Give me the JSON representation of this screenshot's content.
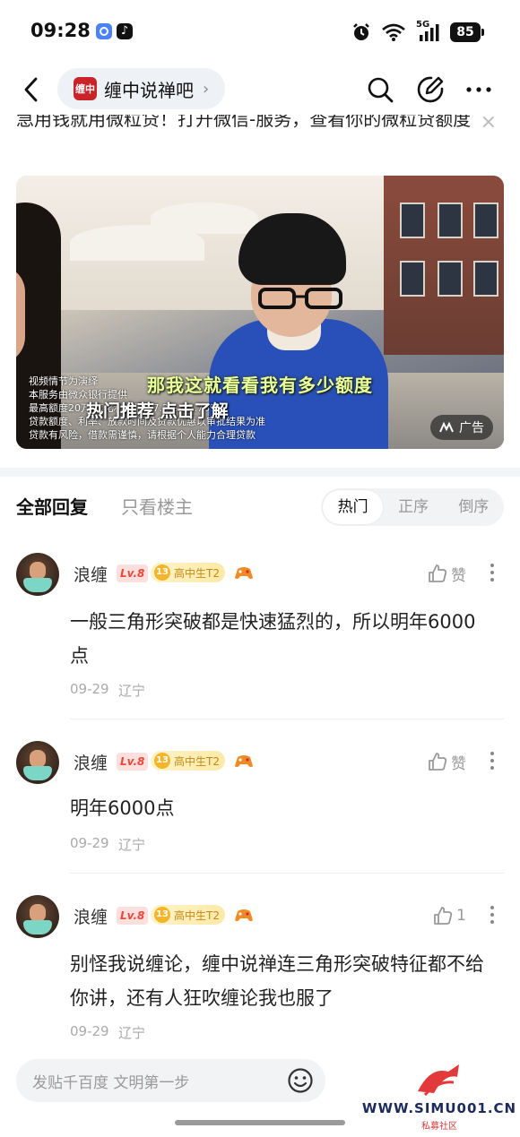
{
  "status_bar": {
    "time": "09:28",
    "network": "5G",
    "battery": "85"
  },
  "nav": {
    "forum_name": "缠中说禅吧",
    "forum_logo_text": "缠中",
    "chevron": "›"
  },
  "post": {
    "text": "急用钱就用微粒贷！打开微信-服务，查看你的微粒贷额度",
    "close": "×"
  },
  "ad": {
    "caption": "那我这就看看我有多少额度",
    "hot_text": "热门推荐 点击了解",
    "small_text": "视频情节为演绎\n本服务由微众银行提供\n最高额度20万 年化利率最低7.2%-23.76%\n贷款额度、利率、放款时间及贷款优惠以审批结果为准\n贷款有风险，借款需谨慎，请根据个人能力合理贷款",
    "badge": "广告"
  },
  "replies": {
    "tab_all": "全部回复",
    "tab_op": "只看楼主",
    "sort": [
      "热门",
      "正序",
      "倒序"
    ],
    "sort_active": 0
  },
  "comments": [
    {
      "user": "浪缠",
      "level": "Lv.8",
      "title_num": "13",
      "title": "高中生T2",
      "like": "赞",
      "text": "一般三角形突破都是快速猛烈的，所以明年6000点",
      "date": "09-29",
      "location": "辽宁"
    },
    {
      "user": "浪缠",
      "level": "Lv.8",
      "title_num": "13",
      "title": "高中生T2",
      "like": "赞",
      "text": "明年6000点",
      "date": "09-29",
      "location": "辽宁"
    },
    {
      "user": "浪缠",
      "level": "Lv.8",
      "title_num": "13",
      "title": "高中生T2",
      "like": "1",
      "text": "别怪我说缠论，缠中说禅连三角形突破特征都不给你讲，还有人狂吹缠论我也服了",
      "date": "09-29",
      "location": "辽宁"
    }
  ],
  "bottom": {
    "input_placeholder": "发贴千百度 文明第一步",
    "watermark_url": "WWW.SIMU001.CN",
    "watermark_sub": "私募社区"
  },
  "colors": {
    "accent_red": "#e9483b",
    "caption_green": "#e9ff9c",
    "badge_gold": "#f5b52a"
  }
}
